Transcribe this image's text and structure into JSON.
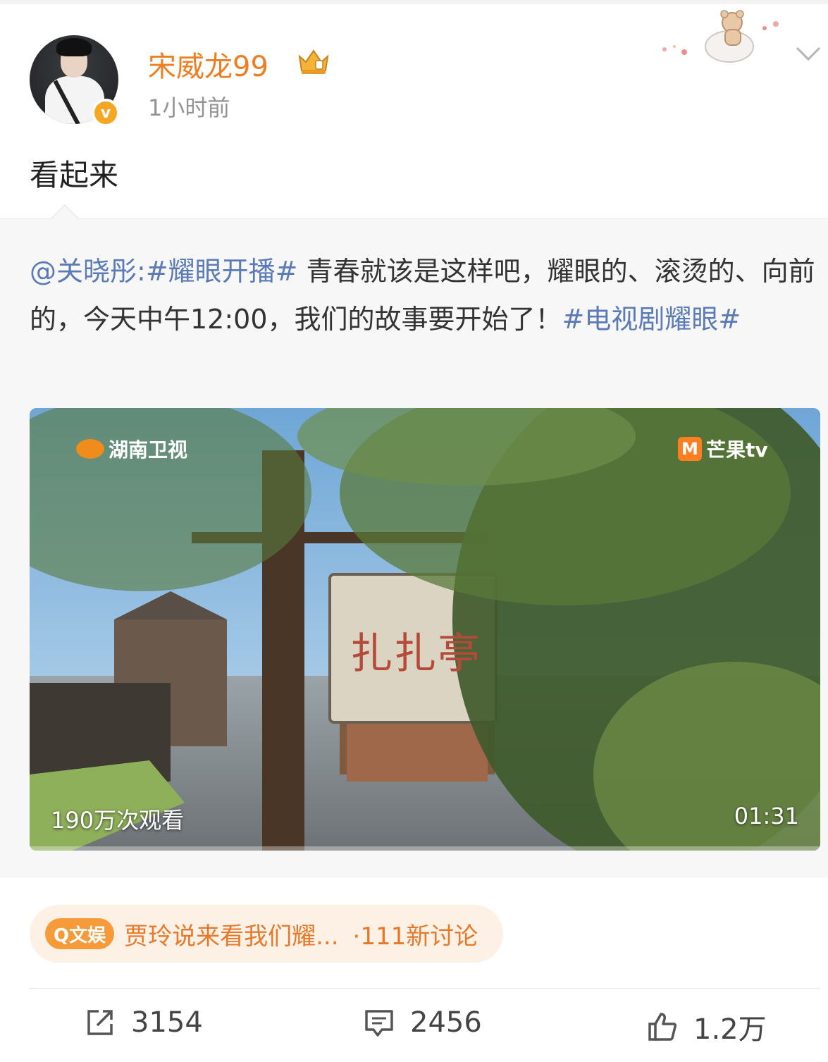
{
  "post": {
    "username": "宋威龙99",
    "time": "1小时前",
    "text": "看起来"
  },
  "repost": {
    "mention": "@关晓彤",
    "colon": ":",
    "hashtag1": "#耀眼开播#",
    "body": " 青春就该是这样吧，耀眼的、滚烫的、向前的，今天中午12:00，我们的故事要开始了！",
    "hashtag2": "#电视剧耀眼#"
  },
  "video": {
    "channel_left": "湖南卫视",
    "channel_right": "芒果tv",
    "views": "190万次观看",
    "duration": "01:31",
    "sign_text": "扎扎亭"
  },
  "topic": {
    "tag": "Q文娱",
    "title": "贾玲说来看我们耀...",
    "count": "·111新讨论"
  },
  "actions": {
    "repost_count": "3154",
    "comment_count": "2456",
    "like_count": "1.2万"
  },
  "colors": {
    "username": "#ef7d22",
    "link": "#5b7ab8",
    "topic_accent": "#e8782a"
  }
}
